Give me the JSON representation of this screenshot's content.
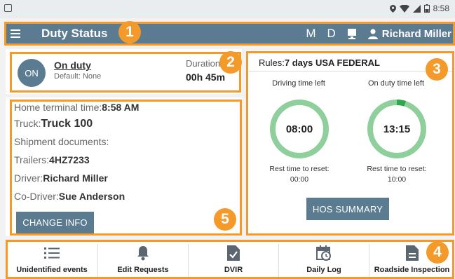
{
  "status_bar": {
    "time": "8:58"
  },
  "app_bar": {
    "title": "Duty Status",
    "mode_m": "M",
    "mode_d": "D",
    "user_name": "Richard  Miller"
  },
  "callouts": [
    "1",
    "2",
    "3",
    "4",
    "5"
  ],
  "duty_panel": {
    "status_short": "ON",
    "status_title": "On duty",
    "status_default": "Default: None",
    "duration_label": "Duration",
    "duration_value": "00h 45m"
  },
  "info_panel": {
    "home_terminal_label": "Home terminal time:",
    "home_terminal_value": "8:58 AM",
    "truck_label": "Truck:",
    "truck_value": "Truck 100",
    "shipment_label": "Shipment documents:",
    "trailers_label": "Trailers:",
    "trailers_value": "4HZ7233",
    "driver_label": "Driver:",
    "driver_value": "Richard  Miller",
    "codriver_label": "Co-Driver:",
    "codriver_value": "Sue  Anderson",
    "change_button": "CHANGE INFO"
  },
  "rules_panel": {
    "rules_label": "Rules:",
    "rules_value": "7 days USA FEDERAL",
    "driving": {
      "label": "Driving time left",
      "value": "08:00",
      "rest_label": "Rest time to reset:",
      "rest_value": "00:00",
      "used_fraction": 0.0
    },
    "onduty": {
      "label": "On duty time left",
      "value": "13:15",
      "rest_label": "Rest time to reset:",
      "rest_value": "10:00",
      "used_fraction": 0.05
    },
    "summary_button": "HOS SUMMARY"
  },
  "colors": {
    "accent": "#5b7b91",
    "callout": "#f39a2b",
    "gauge_track": "#8fcf9b",
    "gauge_fill": "#2ea84a"
  },
  "bottom_nav": [
    {
      "label": "Unidentified events",
      "icon": "list-icon"
    },
    {
      "label": "Edit Requests",
      "icon": "bell-icon"
    },
    {
      "label": "DVIR",
      "icon": "document-check-icon"
    },
    {
      "label": "Daily Log",
      "icon": "calendar-clock-icon"
    },
    {
      "label": "Roadside Inspection",
      "icon": "document-lines-icon"
    }
  ]
}
